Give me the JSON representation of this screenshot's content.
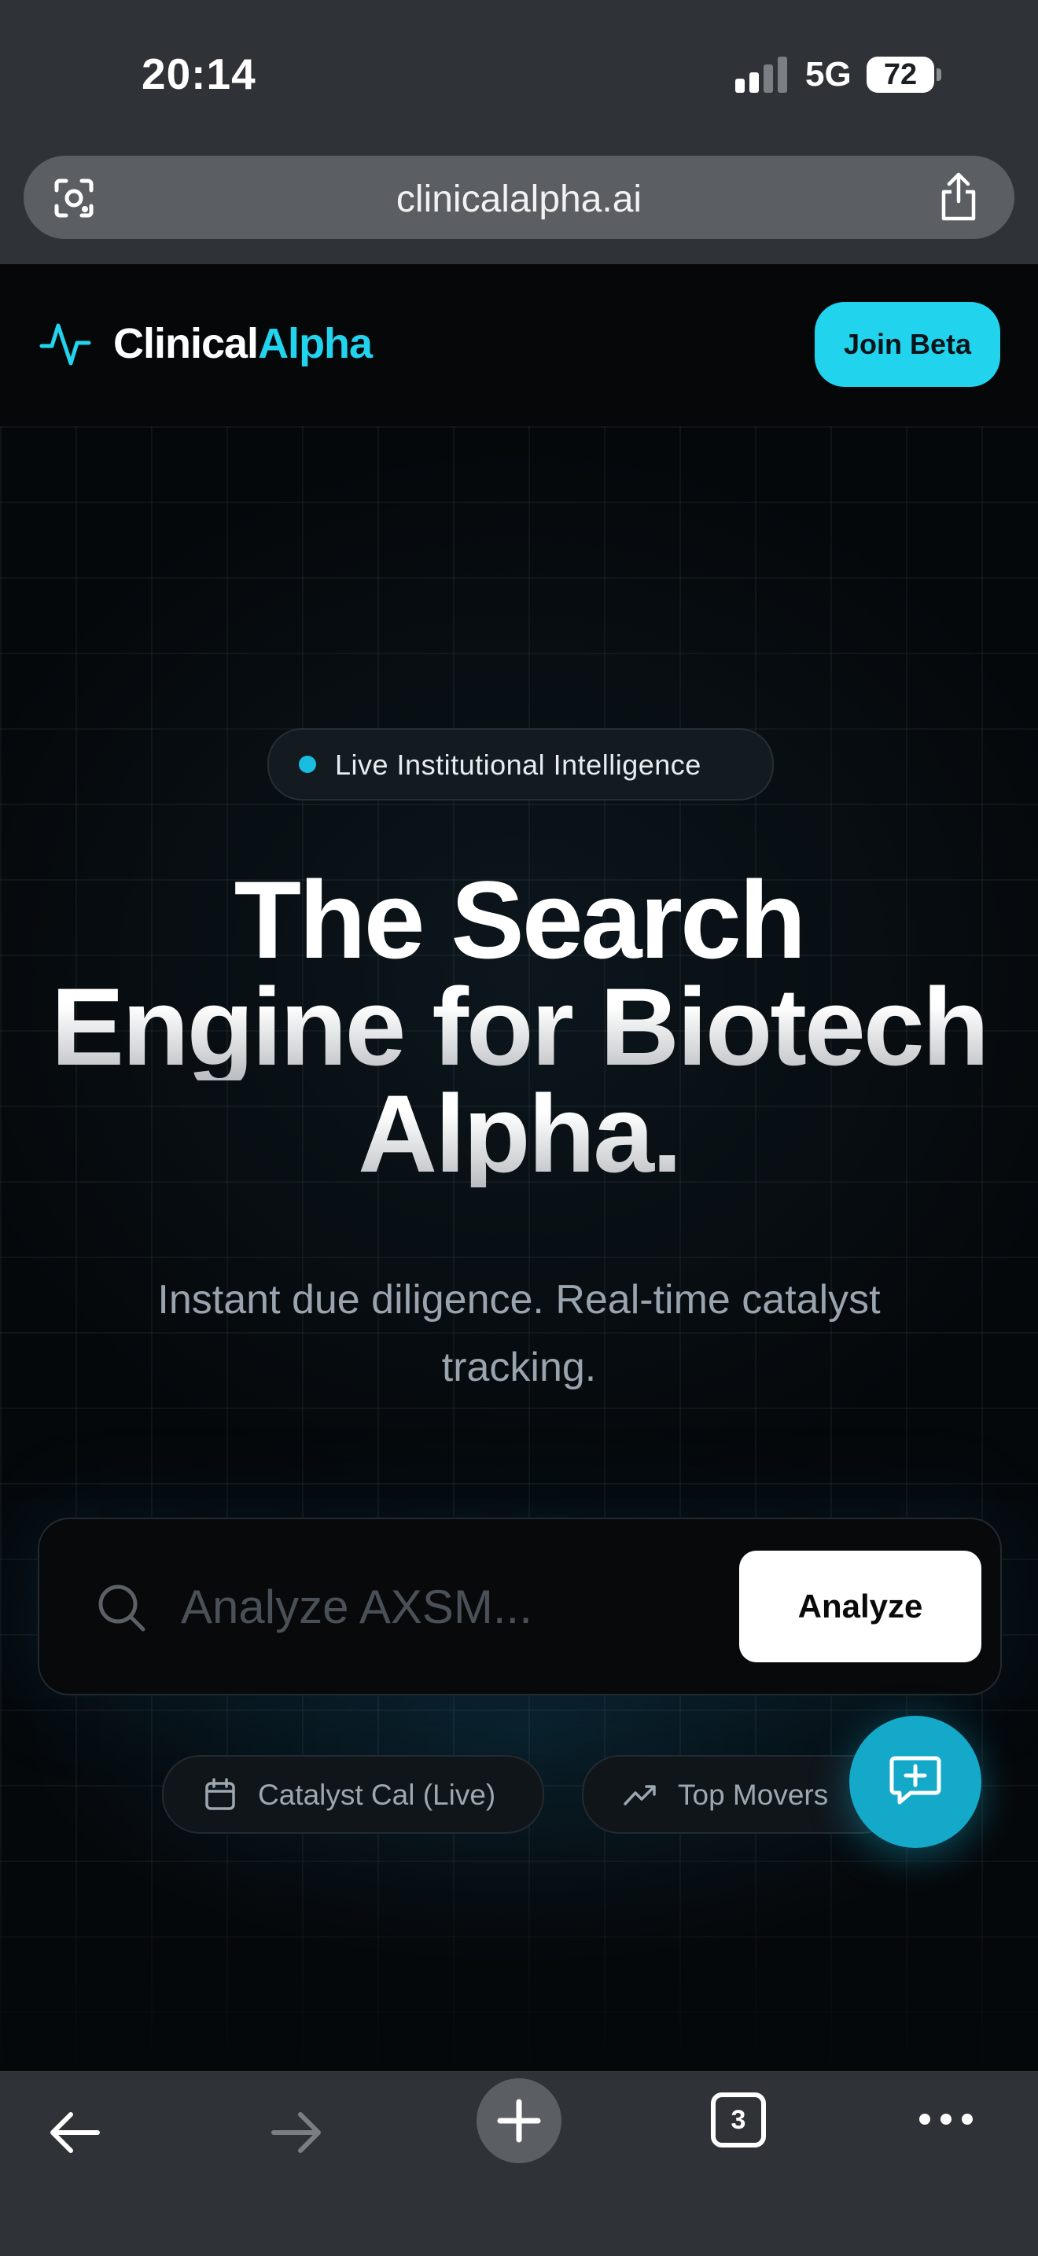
{
  "status_bar": {
    "time": "20:14",
    "network": "5G",
    "battery": "72"
  },
  "browser": {
    "url": "clinicalalpha.ai",
    "tab_count": "3"
  },
  "nav": {
    "logo_part1": "Clinical",
    "logo_part2": "Alpha",
    "join_label": "Join Beta"
  },
  "hero": {
    "pill_label": "Live Institutional Intelligence",
    "headline_line1": "The Search",
    "headline_line2": "Engine for Biotech",
    "headline_line3": "Alpha.",
    "subtitle": "Instant due diligence. Real-time catalyst tracking.",
    "search_placeholder": "Analyze AXSM...",
    "analyze_label": "Analyze",
    "chip_calendar": "Catalyst Cal (Live)",
    "chip_movers": "Top Movers"
  },
  "colors": {
    "accent": "#22d3ee",
    "fab": "#15a9c9",
    "background": "#05080b"
  }
}
